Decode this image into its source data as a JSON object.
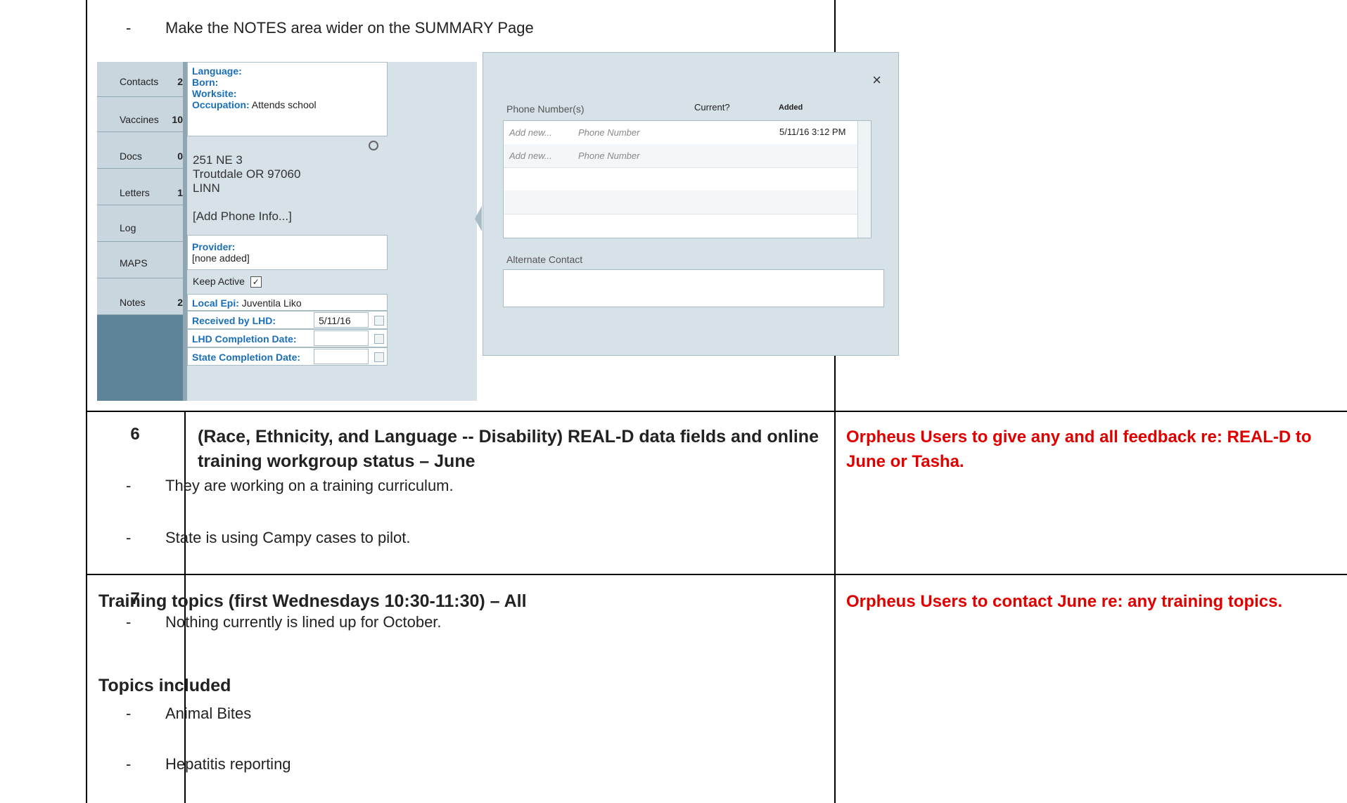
{
  "row5": {
    "bullet": "Make the NOTES area wider on the SUMMARY Page"
  },
  "screenshot": {
    "sidebar": [
      {
        "label": "Contacts",
        "count": "2"
      },
      {
        "label": "Vaccines",
        "count": "10"
      },
      {
        "label": "Docs",
        "count": "0"
      },
      {
        "label": "Letters",
        "count": "1"
      },
      {
        "label": "Log",
        "count": ""
      },
      {
        "label": "MAPS",
        "count": ""
      },
      {
        "label": "Notes",
        "count": "2"
      }
    ],
    "info": {
      "language_label": "Language:",
      "born_label": "Born:",
      "worksite_label": "Worksite:",
      "occupation_label": "Occupation:",
      "occupation_value": "Attends school"
    },
    "address": {
      "line1": "251 NE 3",
      "line2": "Troutdale OR 97060",
      "line3": "LINN",
      "add_phone": "[Add Phone Info...]"
    },
    "provider": {
      "label": "Provider:",
      "value": "[none added]"
    },
    "keep_active": "Keep Active",
    "local_epi": {
      "label": "Local Epi:",
      "value": "Juventila Liko"
    },
    "received": {
      "label": "Received by LHD:",
      "value": "5/11/16"
    },
    "lhd_completion": {
      "label": "LHD Completion Date:"
    },
    "state_completion": {
      "label": "State Completion Date:"
    },
    "popup": {
      "close": "×",
      "phone_header": "Phone Number(s)",
      "current_header": "Current?",
      "added_header": "Added",
      "rows": [
        {
          "add": "Add new...",
          "phone": "Phone Number",
          "added": "5/11/16 3:12 PM"
        },
        {
          "add": "Add new...",
          "phone": "Phone Number",
          "added": ""
        }
      ],
      "alternate_contact": "Alternate Contact"
    }
  },
  "row6": {
    "number": "6",
    "title": "(Race, Ethnicity, and Language -- Disability) REAL-D data fields and online training workgroup status – June",
    "bullets": [
      "They are working on a training curriculum.",
      "State is using Campy cases to pilot."
    ],
    "action": "Orpheus Users to give any and all feedback re: REAL-D to June or Tasha."
  },
  "row7": {
    "number": "7",
    "title": "Training topics (first Wednesdays 10:30-11:30) – All",
    "bullet": "Nothing currently is lined up for October.",
    "subheading": "Topics included",
    "topics": [
      "Animal Bites",
      "Hepatitis reporting"
    ],
    "action": "Orpheus Users to contact June re: any training topics."
  }
}
